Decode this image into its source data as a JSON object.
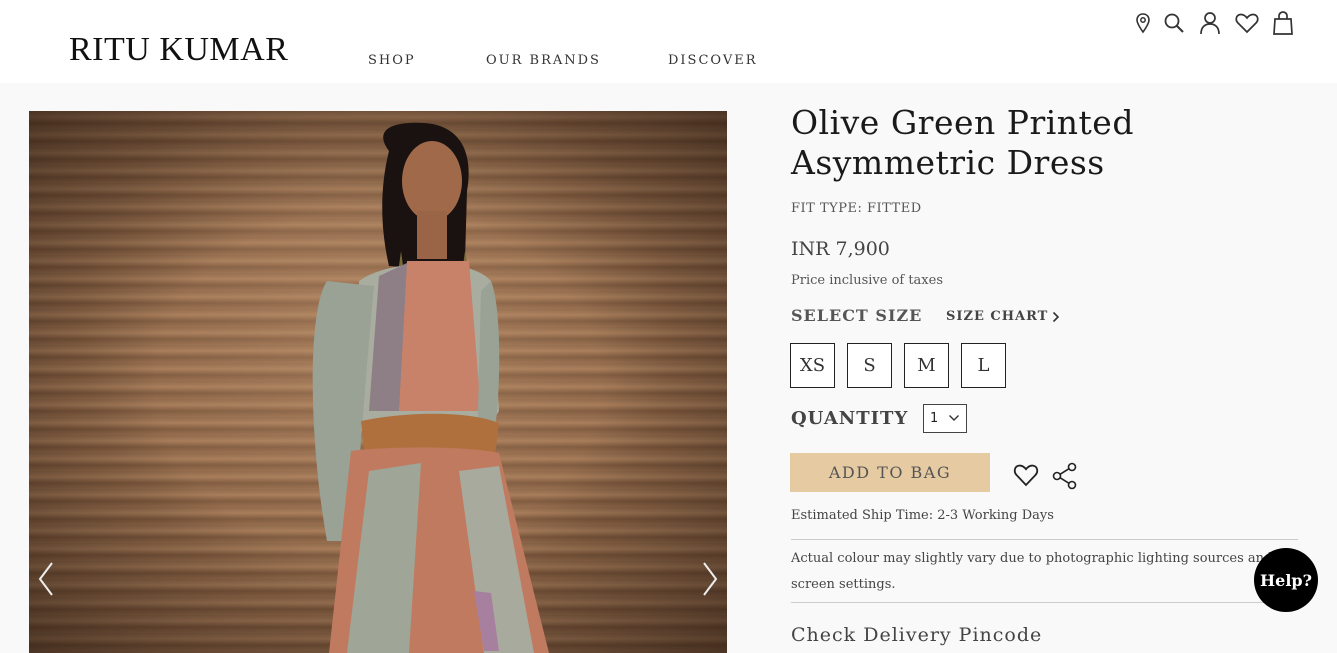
{
  "brand": {
    "logo": "RITU KUMAR"
  },
  "nav": {
    "items": [
      "SHOP",
      "OUR BRANDS",
      "DISCOVER"
    ]
  },
  "header_icons": [
    "location-icon",
    "search-icon",
    "user-icon",
    "heart-icon",
    "bag-icon"
  ],
  "product": {
    "title_line1": "Olive Green Printed",
    "title_line2": "Asymmetric Dress",
    "fit_type": "FIT TYPE: FITTED",
    "price": "INR 7,900",
    "price_note": "Price inclusive of taxes",
    "select_size_label": "SELECT SIZE",
    "size_chart_label": "SIZE CHART",
    "sizes": [
      "XS",
      "S",
      "M",
      "L"
    ],
    "quantity_label": "QUANTITY",
    "quantity_value": "1",
    "add_to_bag": "ADD TO BAG",
    "ship_time": "Estimated Ship Time: 2-3 Working Days",
    "colour_note_line1": "Actual colour may slightly vary due to photographic lighting sources and de",
    "colour_note_line2": "screen settings.",
    "pincode_heading": "Check Delivery Pincode"
  },
  "help": {
    "label": "Help?"
  },
  "colors": {
    "accent": "#e6cba2",
    "text": "#222222",
    "background": "#f9f9f9"
  }
}
